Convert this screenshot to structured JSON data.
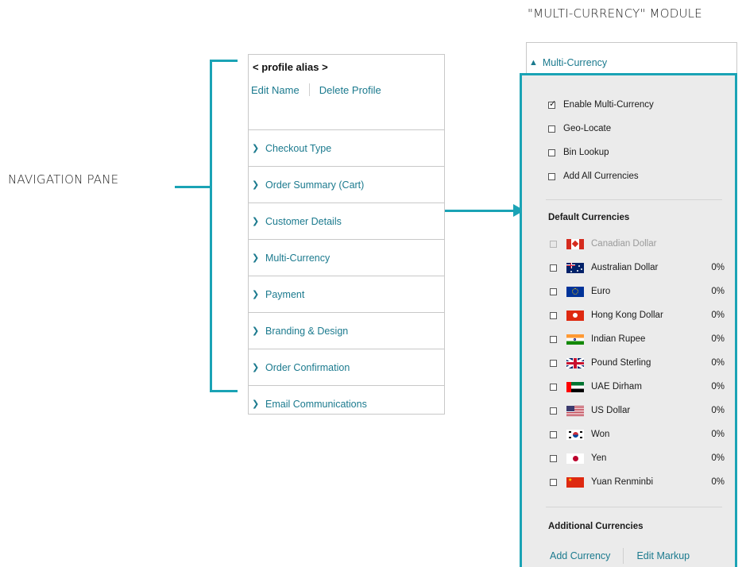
{
  "annotations": {
    "navigation_pane_label": "NAVIGATION PANE",
    "module_label": "\"MULTI-CURRENCY\" MODULE"
  },
  "nav_pane": {
    "profile_alias": "< profile alias >",
    "edit_name": "Edit Name",
    "delete_profile": "Delete Profile",
    "items": [
      {
        "label": "Checkout Type"
      },
      {
        "label": "Order Summary (Cart)"
      },
      {
        "label": "Customer Details"
      },
      {
        "label": "Multi-Currency"
      },
      {
        "label": "Payment"
      },
      {
        "label": "Branding & Design"
      },
      {
        "label": "Order Confirmation"
      },
      {
        "label": "Email Communications"
      }
    ]
  },
  "module": {
    "header": "Multi-Currency",
    "options": [
      {
        "label": "Enable Multi-Currency",
        "checked": true
      },
      {
        "label": "Geo-Locate",
        "checked": false
      },
      {
        "label": "Bin Lookup",
        "checked": false
      },
      {
        "label": "Add All Currencies",
        "checked": false
      }
    ],
    "default_currencies_title": "Default Currencies",
    "currencies": [
      {
        "name": "Canadian Dollar",
        "pct": "",
        "flag": "canada-flag-icon",
        "disabled": true
      },
      {
        "name": "Australian Dollar",
        "pct": "0%",
        "flag": "australia-flag-icon"
      },
      {
        "name": "Euro",
        "pct": "0%",
        "flag": "eu-flag-icon"
      },
      {
        "name": "Hong Kong Dollar",
        "pct": "0%",
        "flag": "hong-kong-flag-icon"
      },
      {
        "name": "Indian Rupee",
        "pct": "0%",
        "flag": "india-flag-icon"
      },
      {
        "name": "Pound Sterling",
        "pct": "0%",
        "flag": "uk-flag-icon"
      },
      {
        "name": "UAE Dirham",
        "pct": "0%",
        "flag": "uae-flag-icon"
      },
      {
        "name": "US Dollar",
        "pct": "0%",
        "flag": "us-flag-icon"
      },
      {
        "name": "Won",
        "pct": "0%",
        "flag": "south-korea-flag-icon"
      },
      {
        "name": "Yen",
        "pct": "0%",
        "flag": "japan-flag-icon"
      },
      {
        "name": "Yuan Renminbi",
        "pct": "0%",
        "flag": "china-flag-icon"
      }
    ],
    "additional_currencies_title": "Additional Currencies",
    "add_currency": "Add Currency",
    "edit_markup": "Edit Markup"
  },
  "colors": {
    "accent_teal": "#1aa3b5",
    "link_teal": "#1b7a8e",
    "panel_gray": "#ebebeb"
  }
}
